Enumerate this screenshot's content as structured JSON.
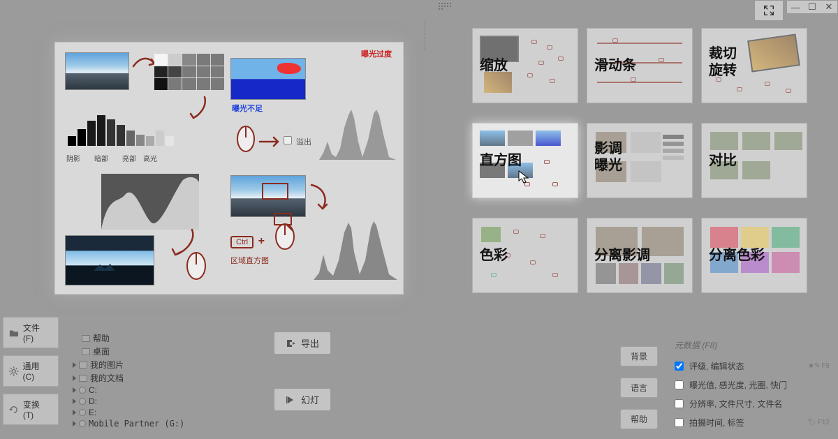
{
  "window": {
    "expand": "expand",
    "min": "—",
    "max": "☐",
    "close": "✕"
  },
  "preview": {
    "tl": {
      "labels": [
        "阴影",
        "暗部",
        "亮部",
        "高光"
      ]
    },
    "tr": {
      "over": "曝光过度",
      "under": "曝光不足",
      "overflow": "溢出"
    },
    "bl": {},
    "br": {
      "ctrl": "Ctrl",
      "plus": "+",
      "label": "区域直方图"
    }
  },
  "tutorials": [
    {
      "t": "缩放"
    },
    {
      "t": "滑动条"
    },
    {
      "t": "裁切\n旋转"
    },
    {
      "t": "直方图",
      "sel": true
    },
    {
      "t": "影调\n曝光"
    },
    {
      "t": "对比"
    },
    {
      "t": "色彩"
    },
    {
      "t": "分离影调"
    },
    {
      "t": "分离色彩"
    }
  ],
  "left_actions": [
    {
      "label": "文件 (F)"
    },
    {
      "label": "通用 (C)"
    },
    {
      "label": "变换 (T)"
    }
  ],
  "tree": [
    {
      "icon": "folder",
      "label": "帮助"
    },
    {
      "icon": "folder",
      "label": "桌面"
    },
    {
      "icon": "folder",
      "tri": true,
      "label": "我的图片"
    },
    {
      "icon": "folder",
      "tri": true,
      "label": "我的文档"
    },
    {
      "icon": "disk",
      "tri": true,
      "label": "C:"
    },
    {
      "icon": "disk",
      "tri": true,
      "label": "D:"
    },
    {
      "icon": "disk",
      "tri": true,
      "label": "E:"
    },
    {
      "icon": "disk",
      "tri": true,
      "label": "Mobile Partner (G:)"
    }
  ],
  "mid_buttons": {
    "export": "导出",
    "slide": "幻灯"
  },
  "right_buttons": [
    "背景",
    "语言",
    "帮助"
  ],
  "metadata": {
    "header": "元数据 (F8)",
    "items": [
      {
        "label": "评级, 编辑状态",
        "checked": true,
        "fkey": "F9",
        "star": true
      },
      {
        "label": "曝光值, 感光度, 光圈, 快门",
        "checked": false
      },
      {
        "label": "分辨率, 文件尺寸, 文件名",
        "checked": false
      },
      {
        "label": "拍摄时间, 标签",
        "checked": false,
        "fkey": "F12",
        "tag": true
      }
    ]
  }
}
